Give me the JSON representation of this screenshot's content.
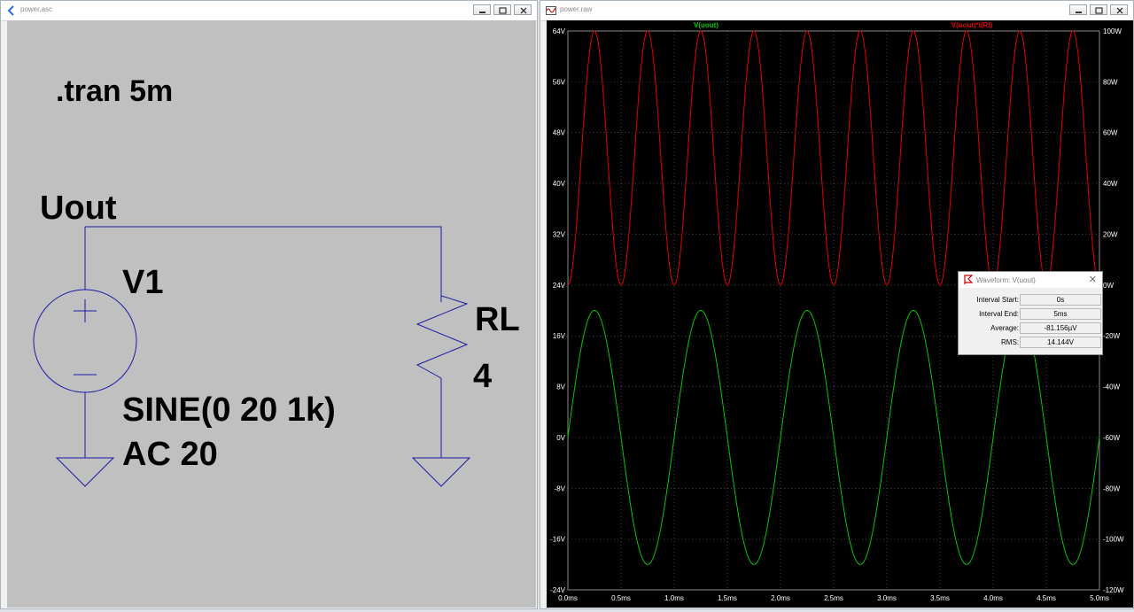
{
  "schematic_window": {
    "title": "power.asc",
    "directive": ".tran 5m",
    "net_label": "Uout",
    "source_name": "V1",
    "source_value": "SINE(0 20 1k)",
    "source_ac": "AC 20",
    "load_name": "RL",
    "load_value": "4",
    "colors": {
      "canvas": "#c0c0c0",
      "wire": "#1a1aa6"
    }
  },
  "plot_window": {
    "title": "power.raw",
    "traces": [
      {
        "label": "V(uout)",
        "color": "#00c800"
      },
      {
        "label": "V(uout)*I(Rl)",
        "color": "#e00000"
      }
    ],
    "left_ticks": [
      "64V",
      "56V",
      "48V",
      "40V",
      "32V",
      "24V",
      "16V",
      "8V",
      "0V",
      "-8V",
      "-16V",
      "-24V"
    ],
    "right_ticks": [
      "100W",
      "80W",
      "60W",
      "40W",
      "20W",
      "0W",
      "-20W",
      "-40W",
      "-60W",
      "-80W",
      "-100W",
      "-120W"
    ],
    "x_ticks": [
      "0.0ms",
      "0.5ms",
      "1.0ms",
      "1.5ms",
      "2.0ms",
      "2.5ms",
      "3.0ms",
      "3.5ms",
      "4.0ms",
      "4.5ms",
      "5.0ms"
    ]
  },
  "waveform_dialog": {
    "title": "Waveform: V(uout)",
    "rows": [
      {
        "label": "Interval Start:",
        "value": "0s"
      },
      {
        "label": "Interval End:",
        "value": "5ms"
      },
      {
        "label": "Average:",
        "value": "-81.156µV"
      },
      {
        "label": "RMS:",
        "value": "14.144V"
      }
    ]
  },
  "chart_data": {
    "type": "line",
    "x_range_ms": [
      0,
      5
    ],
    "y_left_range_V": [
      -24,
      64
    ],
    "y_right_range_W": [
      -120,
      100
    ],
    "series": [
      {
        "name": "V(uout)",
        "axis": "left",
        "function": "20*sin(2*pi*1000*t)",
        "amplitude": 20,
        "frequency_hz": 1000
      },
      {
        "name": "V(uout)*I(Rl)",
        "axis": "right",
        "function": "(20*sin(2*pi*1000*t))^2/4",
        "peak": 100,
        "frequency_hz": 2000
      }
    ],
    "grid": true
  }
}
